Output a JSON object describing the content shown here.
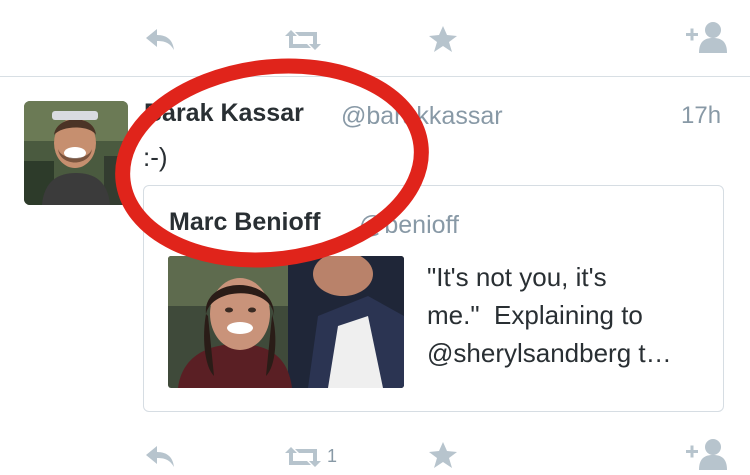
{
  "top_actions": {
    "reply_icon": "reply-icon",
    "retweet_icon": "retweet-icon",
    "favorite_icon": "star-icon",
    "follow_icon": "follow-icon"
  },
  "tweet": {
    "name": "Barak Kassar",
    "handle": "@barakkassar",
    "time": "17h",
    "text": ":-)"
  },
  "quote": {
    "name": "Marc Benioff",
    "handle": "@benioff",
    "text": "\"It's not you, it's\nme.\"  Explaining to\n@sherylsandberg t…"
  },
  "bottom_actions": {
    "retweet_count": "1"
  },
  "colors": {
    "accent_gray": "#a9b8c3",
    "annotation_red": "#e0241b"
  }
}
